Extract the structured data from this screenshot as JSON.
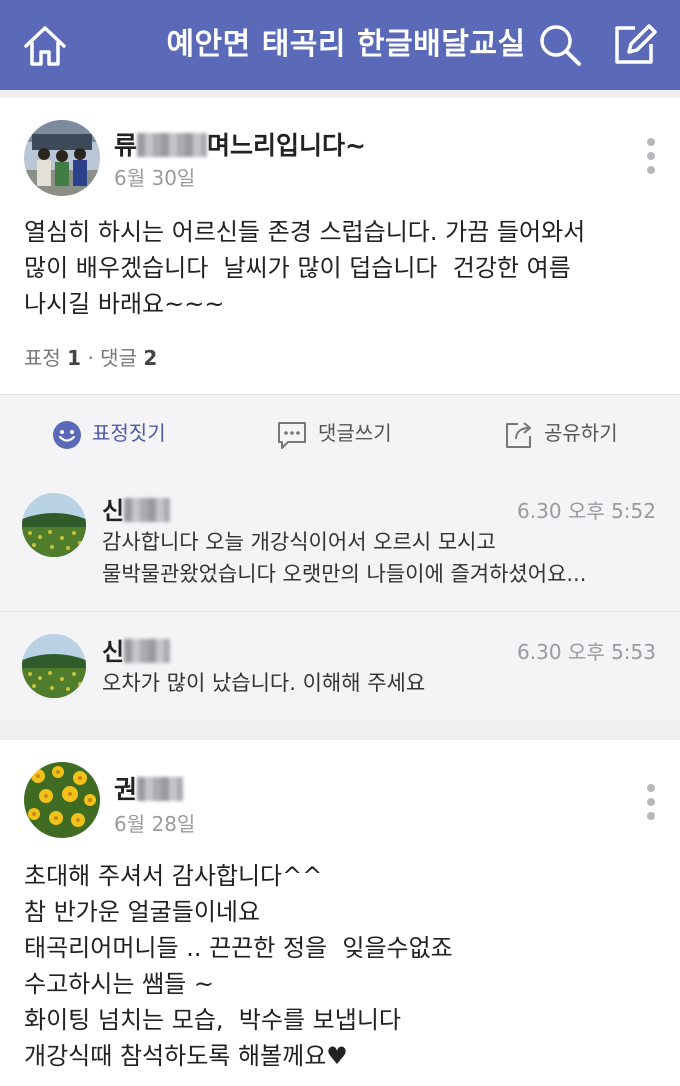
{
  "topbar": {
    "title": "예안면 태곡리 한글배달교실",
    "home_icon": "home-icon",
    "search_icon": "search-icon",
    "edit_icon": "edit-icon"
  },
  "posts": [
    {
      "author_visible": "류",
      "author_suffix": "며느리입니다~",
      "date": "6월 30일",
      "body": "열심히 하시는 어르신들 존경 스럽습니다. 가끔 들어와서\n많이 배우겠습니다  날씨가 많이 덥습니다  건강한 여름\n나시길 바래요~~~",
      "stats": {
        "reaction_label": "표정",
        "reaction_count": "1",
        "comment_label": "댓글",
        "comment_count": "2"
      },
      "actions": {
        "react": "표정짓기",
        "comment": "댓글쓰기",
        "share": "공유하기"
      },
      "comments": [
        {
          "author_visible": "신",
          "time": "6.30 오후 5:52",
          "line1": "감사합니다 오늘 개강식이어서 오르시 모시고",
          "line2": "물박물관왔었습니다 오랫만의 나들이에 즐겨하셨어요..."
        },
        {
          "author_visible": "신",
          "time": "6.30 오후 5:53",
          "line1": "오차가 많이 났습니다. 이해해 주세요"
        }
      ]
    },
    {
      "author_visible": "권",
      "date": "6월 28일",
      "body": "초대해 주셔서 감사합니다^^\n참 반가운 얼굴들이네요\n태곡리어머니들 .. 끈끈한 정을  잊을수없죠\n수고하시는 쌤들 ~\n화이팅 넘치는 모습,  박수를 보냅니다\n개강식때 참석하도록 해볼께요♥"
    }
  ],
  "colors": {
    "topbar": "#5a6ab8",
    "accent": "#4b5bab"
  }
}
